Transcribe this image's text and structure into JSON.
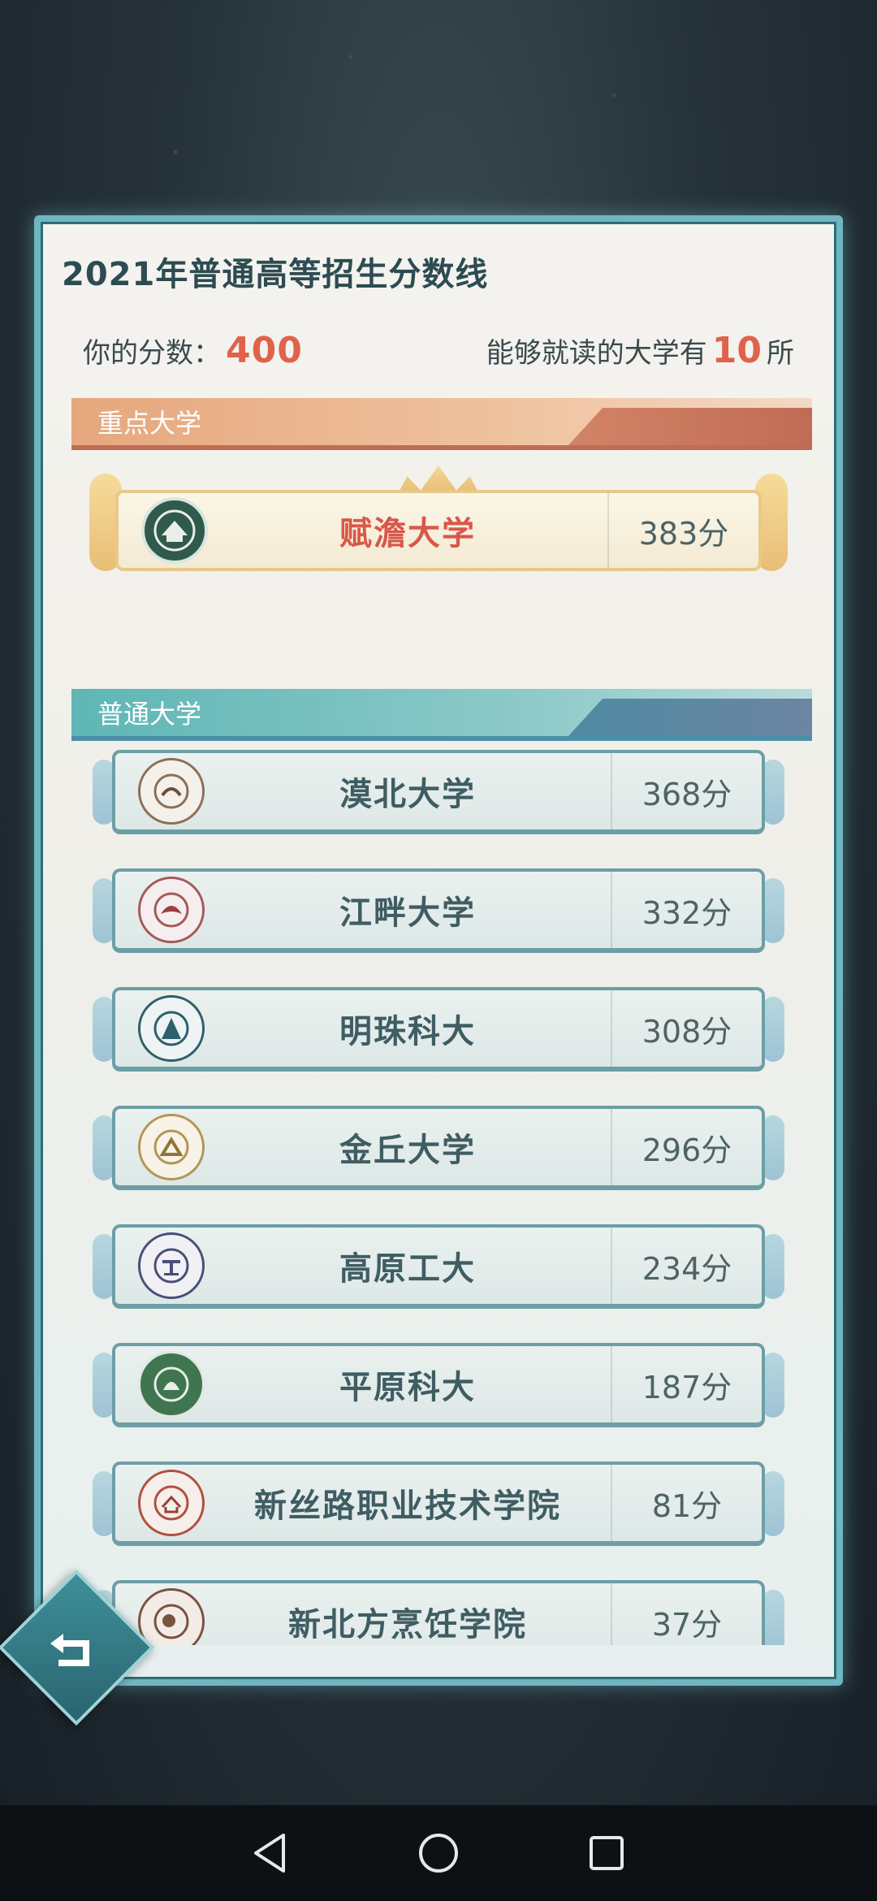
{
  "title": "2021年普通高等招生分数线",
  "score": {
    "label": "你的分数：",
    "value": "400"
  },
  "available": {
    "prefix": "能够就读的大学有",
    "count": "10",
    "suffix": "所"
  },
  "sections": {
    "key": {
      "label": "重点大学"
    },
    "normal": {
      "label": "普通大学"
    }
  },
  "featured": {
    "name": "赋澹大学",
    "score": "383分",
    "logo": "university-seal-icon"
  },
  "universities": [
    {
      "name": "漠北大学",
      "score": "368分",
      "logo": "university-seal-icon"
    },
    {
      "name": "江畔大学",
      "score": "332分",
      "logo": "university-seal-icon"
    },
    {
      "name": "明珠科大",
      "score": "308分",
      "logo": "university-seal-icon"
    },
    {
      "name": "金丘大学",
      "score": "296分",
      "logo": "university-seal-icon"
    },
    {
      "name": "高原工大",
      "score": "234分",
      "logo": "university-seal-icon"
    },
    {
      "name": "平原科大",
      "score": "187分",
      "logo": "university-seal-icon"
    },
    {
      "name": "新丝路职业技术学院",
      "score": "81分",
      "logo": "university-seal-icon"
    },
    {
      "name": "新北方烹饪学院",
      "score": "37分",
      "logo": "university-seal-icon"
    }
  ],
  "colors": {
    "accent_red": "#e0624a",
    "panel_border": "#6fb7c0",
    "key_section": "#e6a77d",
    "normal_section": "#5fb6b6"
  }
}
